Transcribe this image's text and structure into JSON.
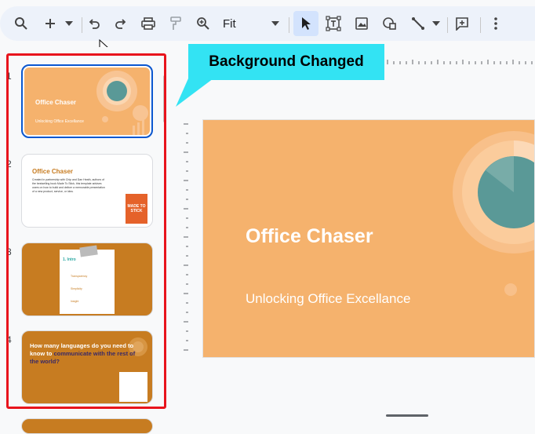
{
  "toolbar": {
    "zoom_label": "Fit",
    "icons": [
      "search-icon",
      "add-icon",
      "dropdown-icon",
      "undo-icon",
      "redo-icon",
      "print-icon",
      "paint-format-icon",
      "zoom-icon",
      "dropdown-icon",
      "select-cursor-icon",
      "text-box-icon",
      "image-icon",
      "shape-icon",
      "line-icon",
      "dropdown-icon",
      "add-comment-icon",
      "more-icon"
    ]
  },
  "annotation": {
    "text": "Background Changed",
    "color": "#33e3f3"
  },
  "filmstrip": {
    "slide_numbers": [
      "1",
      "2",
      "3",
      "4"
    ],
    "slide1": {
      "title": "Office Chaser",
      "subtitle": "Unlocking Office Excellance"
    },
    "slide2": {
      "title": "Office Chaser",
      "body": "Created in partnership with Chip and Dan Heath, authors of the bestselling book Made To Stick, this template advises users on how to build and deliver a memorable presentation of a new product, service, or idea.",
      "book_text": "MADE TO STICK"
    },
    "slide3": {
      "heading": "1. Intro",
      "items": [
        "Transparency",
        "Simplicity",
        "Insight"
      ]
    },
    "slide4": {
      "title_part1": "How many languages do you need to know to",
      "title_highlight": "communicate with",
      "title_part2": "the rest of the world?"
    }
  },
  "slide": {
    "title": "Office Chaser",
    "subtitle": "Unlocking Office Excellance",
    "background": "#f5b26d",
    "accent": "#5a9997"
  },
  "colors": {
    "selection": "#0b57d0",
    "highlight_box": "#e8141c",
    "toolbar_bg": "#edf2fa"
  }
}
